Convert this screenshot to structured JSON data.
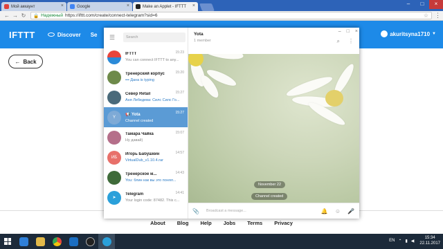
{
  "browser": {
    "tabs": [
      {
        "label": "Мой аккаунт",
        "fav": "#e0413a"
      },
      {
        "label": "Google",
        "fav": "#4285f4"
      },
      {
        "label": "Make an Applet - IFTTT",
        "fav": "#222222",
        "active": true
      }
    ],
    "secure_label": "Надежный",
    "url": "https://ifttt.com/create/connect-telegram?sid=6"
  },
  "ifttt": {
    "logo": "IFTTT",
    "discover": "Discover",
    "search_cut": "Se",
    "username": "akuritsyna1710",
    "back": "Back",
    "footer": [
      "About",
      "Blog",
      "Help",
      "Jobs",
      "Terms",
      "Privacy"
    ]
  },
  "telegram": {
    "search_placeholder": "Search",
    "chats": [
      {
        "name": "IFTTT",
        "preview": "You can connect IFTTT to any...",
        "time": "15:23",
        "avatar_color": "#2b8ad8",
        "icon": "ifttt-avatar"
      },
      {
        "name": "Тренерский корпус",
        "preview": "••• Дана is typing",
        "time": "15:20",
        "avatar_color": "#6e8a4a",
        "icon": "group-avatar",
        "blue": true
      },
      {
        "name": "Север Retail",
        "preview": "Аня Лебедева: Силс Силс Го...",
        "time": "15:27",
        "avatar_color": "#4a6a7a",
        "icon": "group-avatar",
        "blue": true
      },
      {
        "name": "Yota",
        "preview": "Channel created",
        "time": "15:27",
        "avatar_color": "#7eaad6",
        "letter": "Y",
        "selected": true
      },
      {
        "name": "Тамара Чайка",
        "preview": "Ну давай)",
        "time": "15:07",
        "avatar_color": "#b56f8a",
        "icon": "user-avatar"
      },
      {
        "name": "Игорь Бабушкин",
        "preview": "VirtualDub_v1.10.4.rar",
        "time": "14:57",
        "avatar_color": "#e8706a",
        "letter": "ИБ",
        "blue": true
      },
      {
        "name": "Тренерское м...",
        "preview": "You: блин как вы это понял...",
        "time": "14:43",
        "avatar_color": "#3f6b3a",
        "icon": "group-avatar",
        "blue": true
      },
      {
        "name": "Telegram",
        "preview": "Your login code: 87482. This c...",
        "time": "14:41",
        "avatar_color": "#2aa0da",
        "icon": "telegram-avatar"
      }
    ],
    "active_chat": {
      "title": "Yota",
      "subtitle": "1 member",
      "date_pill": "November 22",
      "service_msg": "Channel created",
      "input_placeholder": "Broadcast a message..."
    }
  },
  "taskbar": {
    "lang": "EN",
    "time": "15:34",
    "date": "22.11.2017"
  }
}
